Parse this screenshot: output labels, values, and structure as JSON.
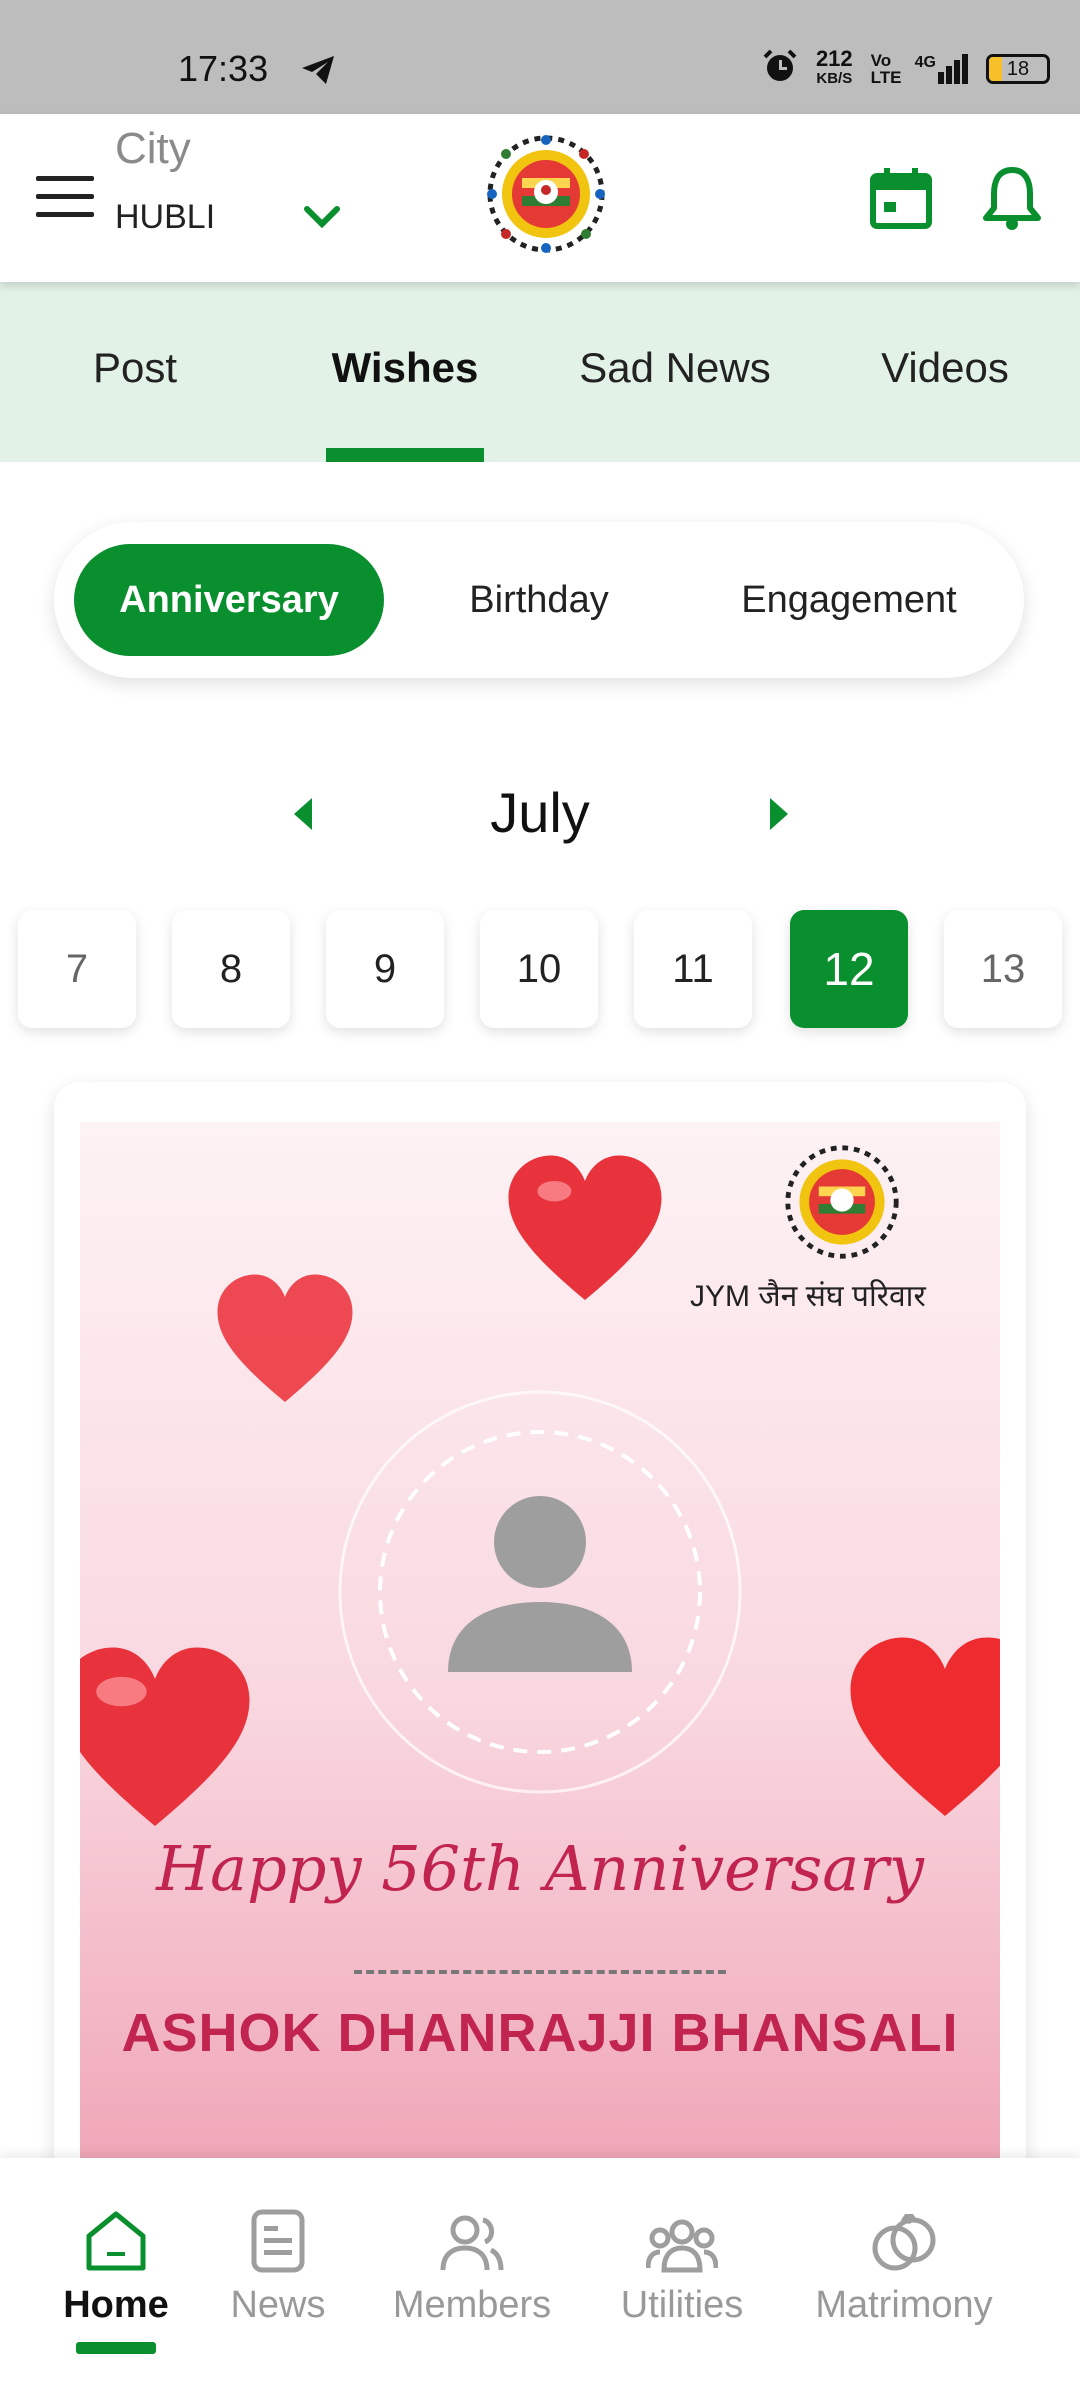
{
  "status_bar": {
    "time": "17:33",
    "net_speed": "212",
    "net_unit": "KB/S",
    "volte": "Vo LTE",
    "network": "4G",
    "battery": "18"
  },
  "header": {
    "city_label": "City",
    "city_value": "HUBLI"
  },
  "top_tabs": [
    {
      "label": "Post"
    },
    {
      "label": "Wishes",
      "active": true
    },
    {
      "label": "Sad News"
    },
    {
      "label": "Videos"
    }
  ],
  "segmented": [
    {
      "label": "Anniversary",
      "active": true
    },
    {
      "label": "Birthday"
    },
    {
      "label": "Engagement"
    }
  ],
  "month": "July",
  "days": [
    {
      "label": "7"
    },
    {
      "label": "8"
    },
    {
      "label": "9"
    },
    {
      "label": "10"
    },
    {
      "label": "11"
    },
    {
      "label": "12",
      "active": true
    },
    {
      "label": "13"
    }
  ],
  "card": {
    "brand": "JYM जैन संघ परिवार",
    "headline": "Happy 56th Anniversary",
    "name": "ASHOK DHANRAJJI BHANSALI"
  },
  "bottom_nav": [
    {
      "label": "Home",
      "active": true
    },
    {
      "label": "News"
    },
    {
      "label": "Members"
    },
    {
      "label": "Utilities"
    },
    {
      "label": "Matrimony"
    }
  ],
  "colors": {
    "accent": "#0a8f2e",
    "tab_bar_bg": "#e3f2e6",
    "headline": "#c0244f"
  }
}
